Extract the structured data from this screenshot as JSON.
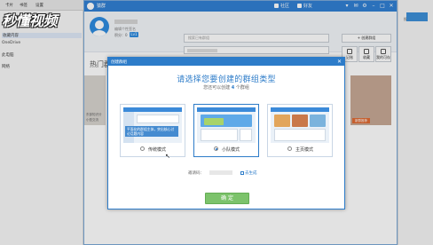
{
  "host": {
    "menu": [
      "卡片",
      "书签",
      "设置"
    ],
    "sidebar_items": [
      "收藏内容",
      "OneDrive",
      "此电脑",
      "网络"
    ],
    "right_hint": "搜索\"聚云网\""
  },
  "logo": {
    "text": "秒懂视频"
  },
  "app": {
    "title": "猿群",
    "nav": {
      "group": "社区",
      "friends": "好友"
    },
    "window_buttons": [
      "▾",
      "✉",
      "⚙",
      "–",
      "□",
      "✕"
    ],
    "profile": {
      "signature": "编辑个性签名",
      "rank_label": "积分：",
      "rank_value": "0",
      "badge": "Lv1"
    },
    "search_placeholder": "搜索已有群组",
    "create_button": "+ 创建群组",
    "tools": [
      "记账",
      "收藏",
      "我的可存"
    ],
    "section_title": "热门群组",
    "bg_card_texts": [
      "东部知识分",
      "小型交流"
    ],
    "bg_card_tag": "新群推荐"
  },
  "modal": {
    "title": "创建群组",
    "close": "✕",
    "headline": "请选择您要创建的群组类型",
    "sub_prefix": "您还可以创建",
    "sub_count": "4",
    "sub_suffix": "个群组",
    "options": [
      {
        "label": "传统模式",
        "selected": false,
        "overlay": "平面化的群组主体，突出核心讨论话题内容"
      },
      {
        "label": "小队模式",
        "selected": true
      },
      {
        "label": "主页模式",
        "selected": false
      }
    ],
    "invite_label": "邀请码：",
    "invite_link": "去生成",
    "confirm": "确 定"
  },
  "colors": {
    "accent": "#2d7cc9",
    "confirm": "#7cc36b",
    "titlebar": "#2f7fd3"
  }
}
